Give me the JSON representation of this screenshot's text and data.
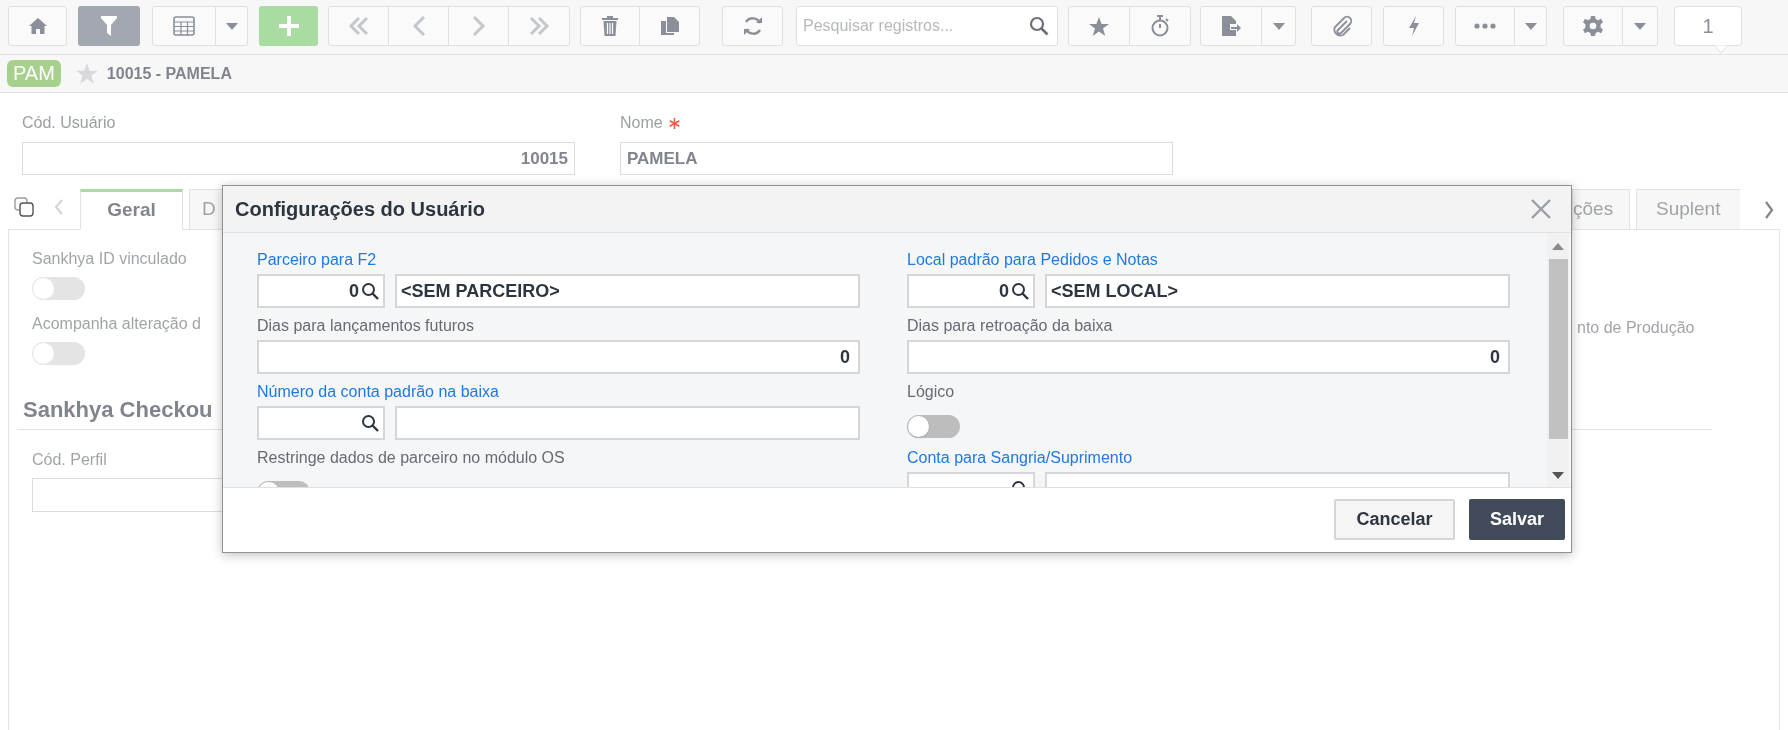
{
  "toolbar": {
    "filter_active": true,
    "search": {
      "placeholder": "Pesquisar registros..."
    },
    "record_count": "1"
  },
  "record": {
    "badge": "PAM",
    "favorite": false,
    "title": "10015 - PAMELA"
  },
  "form": {
    "fields": [
      {
        "label": "Cód. Usuário",
        "required": false,
        "value": "10015",
        "kind": "number"
      },
      {
        "label": "Nome",
        "required": true,
        "value": "PAMELA",
        "kind": "text"
      }
    ]
  },
  "tabs": [
    {
      "label": "Geral",
      "selected": true
    },
    {
      "label": "D",
      "selected": false
    },
    {
      "label": "ções",
      "selected": false
    },
    {
      "label": "Suplent",
      "selected": false
    }
  ],
  "panel": {
    "toggles": [
      {
        "label": "Sankhya ID vinculado",
        "on": false
      },
      {
        "label": "Acompanha alteração d",
        "on": false
      }
    ],
    "right_label": "nto de Produção",
    "section_title": "Sankhya Checkou",
    "fields": [
      {
        "label": "Cód. Perfil"
      }
    ]
  },
  "dialog": {
    "title": "Configurações do Usuário",
    "left": [
      {
        "kind": "lookup",
        "label": "Parceiro para F2",
        "link": true,
        "code": "0",
        "description": "<SEM PARCEIRO>"
      },
      {
        "kind": "number",
        "label": "Dias para lançamentos futuros",
        "link": false,
        "value": "0"
      },
      {
        "kind": "lookup",
        "label": "Número da conta padrão na baixa",
        "link": true
      },
      {
        "kind": "toggle",
        "label": "Restringe dados de parceiro no módulo OS",
        "link": false,
        "on": false
      }
    ],
    "right": [
      {
        "kind": "lookup",
        "label": "Local padrão para Pedidos e Notas",
        "link": true,
        "code": "0",
        "description": "<SEM LOCAL>"
      },
      {
        "kind": "number",
        "label": "Dias para retroação da baixa",
        "link": false,
        "value": "0"
      },
      {
        "kind": "toggle",
        "label": "Lógico",
        "link": false,
        "on": false
      },
      {
        "kind": "lookup",
        "label": "Conta para Sangria/Suprimento",
        "link": true
      }
    ],
    "buttons": [
      {
        "label": "Cancelar",
        "kind": "secondary"
      },
      {
        "label": "Salvar",
        "kind": "primary"
      }
    ]
  }
}
